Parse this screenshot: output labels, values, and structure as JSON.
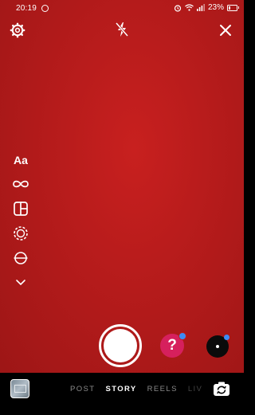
{
  "status_bar": {
    "time": "20:19",
    "battery_percent": "23%",
    "battery_level": 0.23
  },
  "top_bar": {
    "settings_icon": "settings-gear-icon",
    "flash_icon": "flash-off-icon",
    "close_icon": "close-icon"
  },
  "side_tools": [
    {
      "name": "create-mode",
      "label": "Aa",
      "icon": "text-create-icon"
    },
    {
      "name": "boomerang",
      "label": "",
      "icon": "infinity-icon"
    },
    {
      "name": "layout",
      "label": "",
      "icon": "layout-grid-icon"
    },
    {
      "name": "superzoom",
      "label": "",
      "icon": "dashed-circle-icon"
    },
    {
      "name": "level",
      "label": "",
      "icon": "level-circle-icon"
    },
    {
      "name": "more",
      "label": "",
      "icon": "chevron-down-icon"
    }
  ],
  "capture": {
    "question_sticker_label": "?",
    "question_badge": true,
    "effect_badge": true
  },
  "modes": {
    "tabs": [
      "POST",
      "STORY",
      "REELS",
      "LIV"
    ],
    "active": "STORY"
  },
  "colors": {
    "background": "#b51b1b",
    "question_sticker": "#d6205d",
    "badge": "#3d8cf5"
  }
}
